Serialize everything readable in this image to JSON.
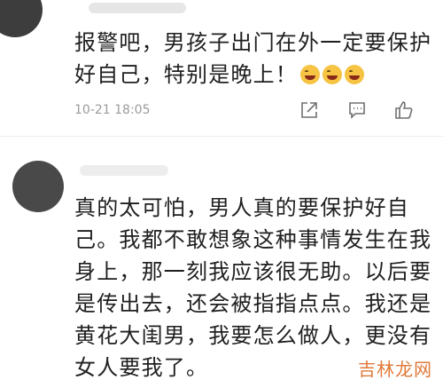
{
  "comments": [
    {
      "lines": [
        "报警吧，男孩子出门在外一定要保护",
        "好自己，特别是晚上！"
      ],
      "emoji_count": 3,
      "emoji_icon": "laugh-cry-emoji",
      "timestamp": "10-21 18:05",
      "actions": [
        "share-icon",
        "comment-icon",
        "like-icon"
      ]
    },
    {
      "lines": [
        "真的太可怕，男人真的要保护好自",
        "己。我都不敢想象这种事情发生在我",
        "身上，那一刻我应该很无助。以后要",
        "是传出去，还会被指指点点。我还是",
        "黄花大闺男，我要怎么做人，更没有",
        "女人要我了。"
      ]
    }
  ],
  "watermark": "吉林龙网"
}
